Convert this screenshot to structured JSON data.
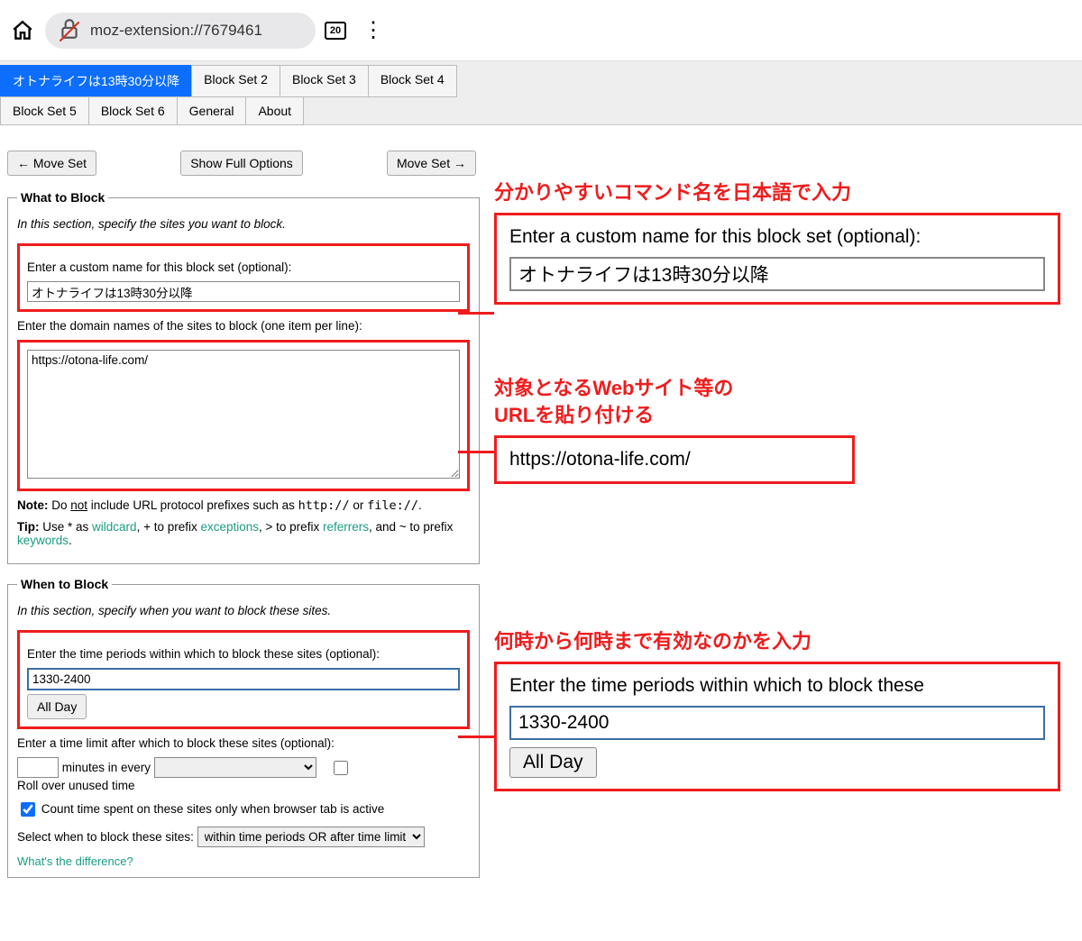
{
  "browser": {
    "url": "moz-extension://7679461",
    "tab_count": "20"
  },
  "tabs": {
    "row1": [
      "オトナライフは13時30分以降",
      "Block Set 2",
      "Block Set 3",
      "Block Set 4"
    ],
    "row2": [
      "Block Set 5",
      "Block Set 6",
      "General",
      "About"
    ]
  },
  "buttons": {
    "move_left": "← Move Set",
    "show_full": "Show Full Options",
    "move_right": "Move Set →",
    "all_day": "All Day"
  },
  "what": {
    "legend": "What to Block",
    "desc": "In this section, specify the sites you want to block.",
    "custom_name_label": "Enter a custom name for this block set (optional):",
    "custom_name_value": "オトナライフは13時30分以降",
    "domains_label": "Enter the domain names of the sites to block (one item per line):",
    "domains_value": "https://otona-life.com/",
    "note_prefix": "Note:",
    "note_text1": " Do ",
    "note_not": "not",
    "note_text2": " include URL protocol prefixes such as ",
    "note_http": "http://",
    "note_or": " or ",
    "note_file": "file://",
    "tip_prefix": "Tip:",
    "tip_text1": " Use * as ",
    "tip_wildcard": "wildcard",
    "tip_text2": ", + to prefix ",
    "tip_exceptions": "exceptions",
    "tip_text3": ", > to prefix ",
    "tip_referrers": "referrers",
    "tip_text4": ", and ~ to prefix ",
    "tip_keywords": "keywords",
    "tip_end": "."
  },
  "when": {
    "legend": "When to Block",
    "desc": "In this section, specify when you want to block these sites.",
    "periods_label": "Enter the time periods within which to block these sites (optional):",
    "periods_value": "1330-2400",
    "limit_label": "Enter a time limit after which to block these sites (optional):",
    "minutes_in_every": "minutes in every",
    "rollover": "Roll over unused time",
    "count_active": "Count time spent on these sites only when browser tab is active",
    "select_when": "Select when to block these sites:",
    "select_value": "within time periods OR after time limit",
    "whats_diff": "What's the difference?"
  },
  "callouts": {
    "c1_title": "分かりやすいコマンド名を日本語で入力",
    "c1_label": "Enter a custom name for this block set (optional):",
    "c1_value": "オトナライフは13時30分以降",
    "c2_title_l1": "対象となるWebサイト等の",
    "c2_title_l2": "URLを貼り付ける",
    "c2_value": "https://otona-life.com/",
    "c3_title": "何時から何時まで有効なのかを入力",
    "c3_label": "Enter the time periods within which to block these",
    "c3_value": "1330-2400",
    "c3_btn": "All Day"
  }
}
